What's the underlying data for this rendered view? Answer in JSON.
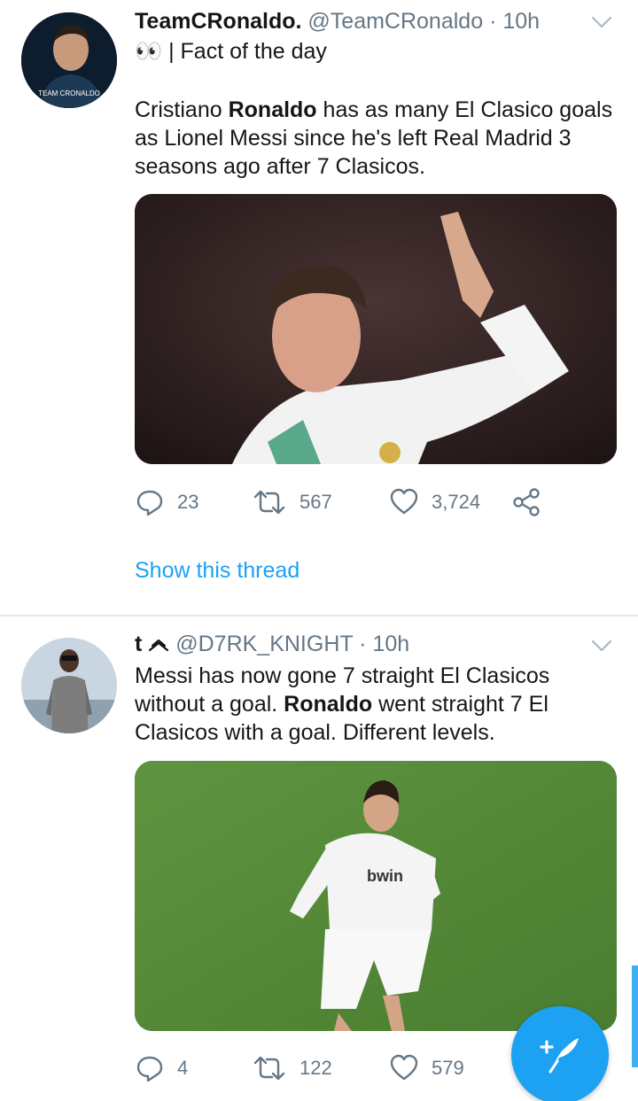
{
  "tweets": [
    {
      "display_name": "TeamCRonaldo.",
      "handle": "@TeamCRonaldo",
      "separator": "·",
      "time": "10h",
      "text_lines": [
        "👀 | Fact of the day",
        "",
        "Cristiano ",
        "Ronaldo",
        " has as many El Clasico goals as Lionel Messi since he's left Real Madrid 3 seasons ago after 7 Clasicos."
      ],
      "counts": {
        "replies": "23",
        "retweets": "567",
        "likes": "3,724"
      },
      "show_thread": "Show this thread",
      "avatar_text": "TEAM CRONALDO"
    },
    {
      "display_name": "t",
      "handle": "@D7RK_KNIGHT",
      "separator": "·",
      "time": "10h",
      "text_lines": [
        "Messi has now gone 7 straight El Clasicos without a goal. ",
        "Ronaldo",
        " went straight 7 El Clasicos with a goal. Different levels."
      ],
      "counts": {
        "replies": "4",
        "retweets": "122",
        "likes": "579"
      }
    }
  ],
  "icons": {
    "reply": "reply-icon",
    "retweet": "retweet-icon",
    "like": "heart-icon",
    "share": "share-icon",
    "menu": "chevron-down-icon",
    "compose": "compose-icon"
  },
  "colors": {
    "accent": "#1da1f2",
    "secondary_text": "#657786",
    "divider": "#e1e8ed"
  }
}
